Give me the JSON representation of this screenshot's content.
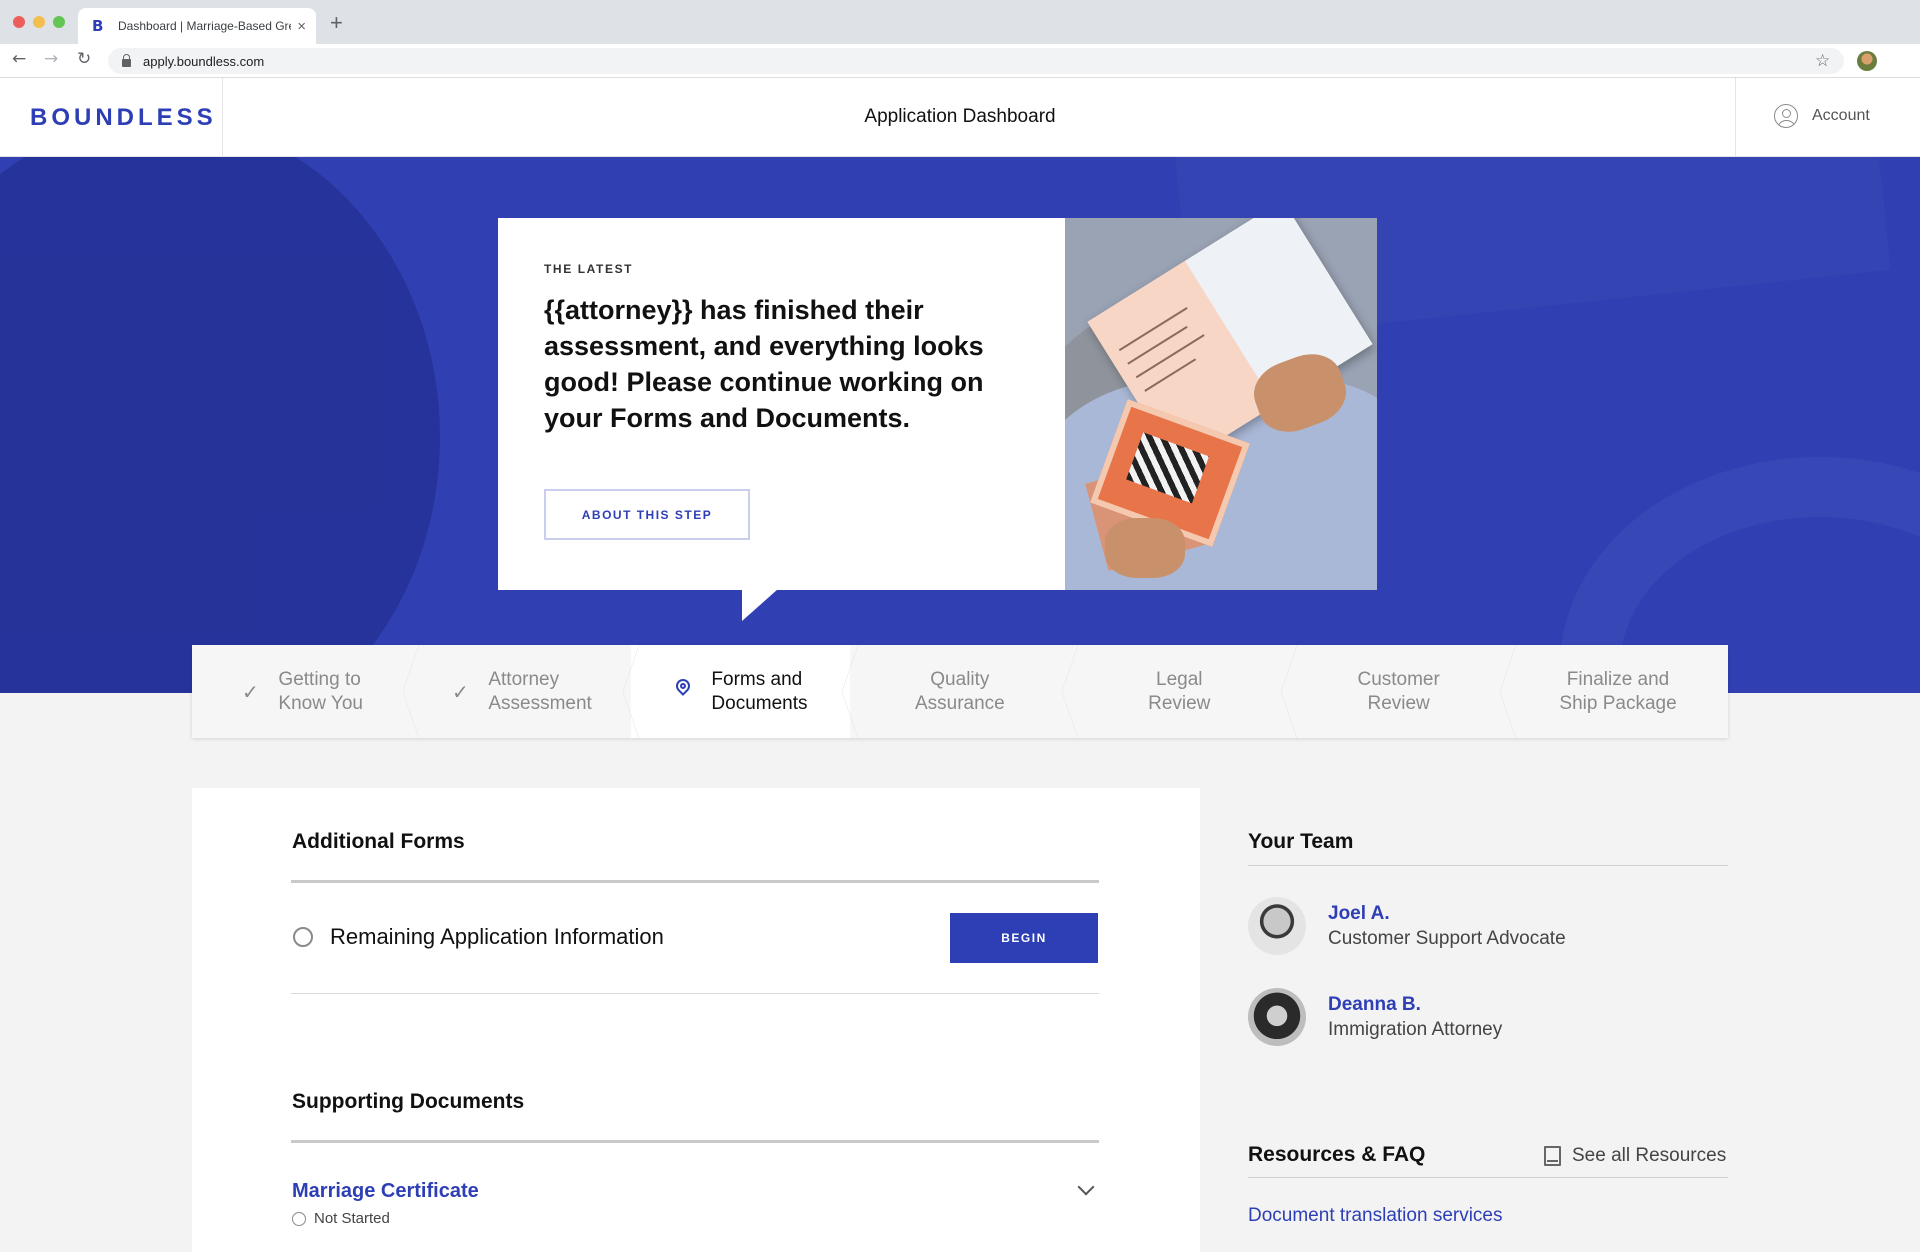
{
  "browser": {
    "tab_title": "Dashboard | Marriage-Based Gre",
    "favicon": "B",
    "url": "apply.boundless.com"
  },
  "header": {
    "logo": "BOUNDLESS",
    "title": "Application Dashboard",
    "account_label": "Account"
  },
  "latest": {
    "eyebrow": "THE LATEST",
    "headline": "{{attorney}} has finished their assessment, and everything looks good! Please continue working on your Forms and Documents.",
    "button_label": "ABOUT THIS STEP"
  },
  "steps": [
    {
      "line1": "Getting to",
      "line2": "Know You",
      "status": "done",
      "icon": "check-icon"
    },
    {
      "line1": "Attorney",
      "line2": "Assessment",
      "status": "done",
      "icon": "check-icon"
    },
    {
      "line1": "Forms and",
      "line2": "Documents",
      "status": "active",
      "icon": "location-pin-icon"
    },
    {
      "line1": "Quality",
      "line2": "Assurance",
      "status": "future"
    },
    {
      "line1": "Legal",
      "line2": "Review",
      "status": "future"
    },
    {
      "line1": "Customer",
      "line2": "Review",
      "status": "future"
    },
    {
      "line1": "Finalize and",
      "line2": "Ship Package",
      "status": "future"
    }
  ],
  "additional_forms": {
    "title": "Additional Forms",
    "items": [
      {
        "label": "Remaining Application Information",
        "button": "BEGIN"
      }
    ]
  },
  "supporting_documents": {
    "title": "Supporting Documents",
    "items": [
      {
        "label": "Marriage Certificate",
        "status": "Not Started"
      }
    ]
  },
  "team": {
    "title": "Your Team",
    "members": [
      {
        "name": "Joel A.",
        "role": "Customer Support Advocate"
      },
      {
        "name": "Deanna B.",
        "role": "Immigration Attorney"
      }
    ]
  },
  "resources": {
    "title": "Resources & FAQ",
    "see_all": "See all Resources",
    "links": [
      "Document translation services"
    ]
  },
  "colors": {
    "brand_blue": "#2e3fb5",
    "background": "#f2f3f2"
  }
}
